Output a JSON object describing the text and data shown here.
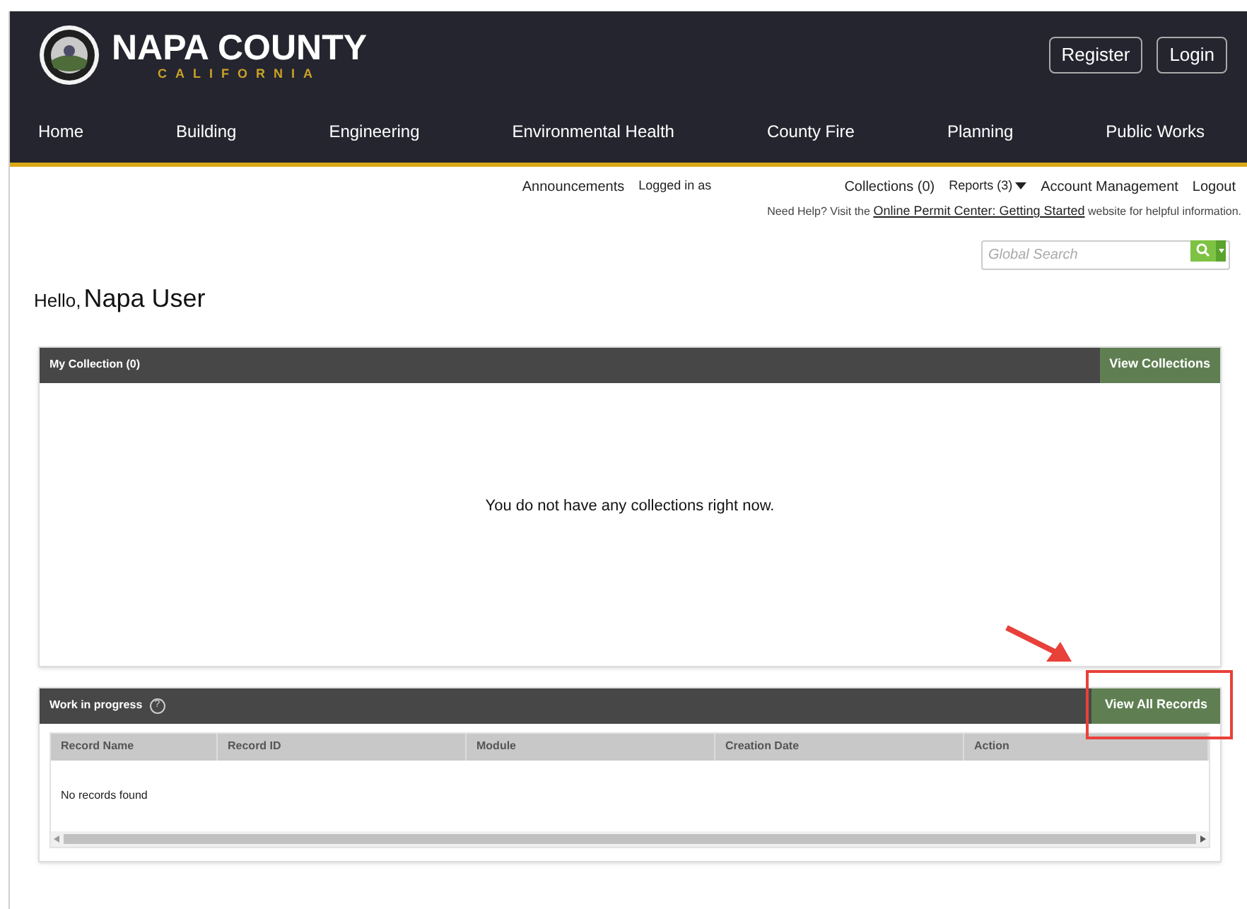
{
  "header": {
    "title": "NAPA COUNTY",
    "subtitle": "CALIFORNIA",
    "buttons": [
      "Register",
      "Login"
    ]
  },
  "nav": [
    "Home",
    "Building",
    "Engineering",
    "Environmental Health",
    "County Fire",
    "Planning",
    "Public Works"
  ],
  "top_links": {
    "announcements": "Announcements",
    "logged_in": "Logged in as",
    "collections": "Collections (0)",
    "reports": "Reports (3)",
    "account": "Account Management",
    "logout": "Logout"
  },
  "help": {
    "before": "Need Help? Visit the",
    "link": "Online Permit Center: Getting Started",
    "after": "website for helpful information."
  },
  "search": {
    "placeholder": "Global Search"
  },
  "greeting": {
    "hello": "Hello,",
    "name": "Napa User"
  },
  "collection": {
    "title": "My Collection (0)",
    "button": "View Collections",
    "message": "You do not have any collections right now."
  },
  "work_in_progress": {
    "title": "Work in progress",
    "button": "View All Records",
    "help_icon": "?",
    "columns": [
      "Record Name",
      "Record ID",
      "Module",
      "Creation Date",
      "Action"
    ],
    "empty": "No records found"
  }
}
